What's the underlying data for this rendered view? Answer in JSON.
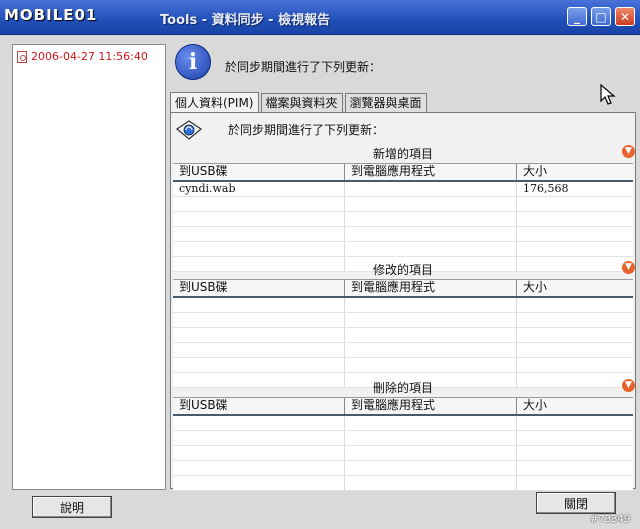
{
  "watermark": {
    "logo": "MOBILE01",
    "id": "#73349"
  },
  "window": {
    "title": "Tools - 資料同步 - 檢視報告",
    "buttons": {
      "minimize": "_",
      "maximize": "□",
      "close": "✕"
    }
  },
  "log": {
    "entries": [
      {
        "timestamp": "2006-04-27 11:56:40"
      }
    ]
  },
  "header": {
    "message": "於同步期間進行了下列更新："
  },
  "tabs": [
    {
      "label": "個人資料(PIM)",
      "active": true
    },
    {
      "label": "檔案與資料夾",
      "active": false
    },
    {
      "label": "瀏覽器與桌面",
      "active": false
    }
  ],
  "panel": {
    "message": "於同步期間進行了下列更新：",
    "columns": [
      "到USB碟",
      "到電腦應用程式",
      "大小"
    ],
    "sections": [
      {
        "title": "新增的項目",
        "rows": [
          [
            "cyndi.wab",
            "",
            "176,568"
          ]
        ]
      },
      {
        "title": "修改的項目",
        "rows": []
      },
      {
        "title": "刪除的項目",
        "rows": []
      }
    ]
  },
  "buttons": {
    "help": "說明",
    "close": "關閉"
  }
}
